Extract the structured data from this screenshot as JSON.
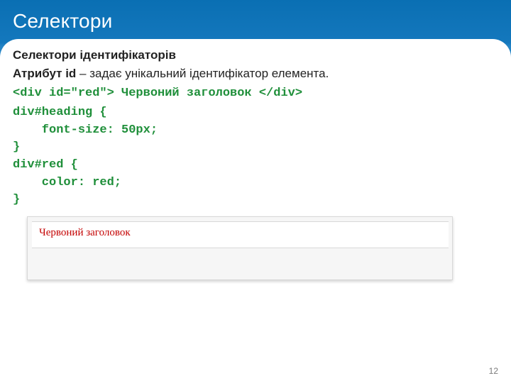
{
  "title": "Селектори",
  "subtitle": "Селектори ідентифікаторів",
  "desc_prefix": "Атрибут ",
  "desc_attr": "id",
  "desc_suffix": " – задає унікальний ідентифікатор елемента.",
  "code_html": "<div id=\"red\"> Червоний заголовок </div>",
  "code_css": "div#heading {\n    font-size: 50px;\n}\ndiv#red {\n    color: red;\n}",
  "example_text": "Червоний заголовок",
  "page_number": "12"
}
